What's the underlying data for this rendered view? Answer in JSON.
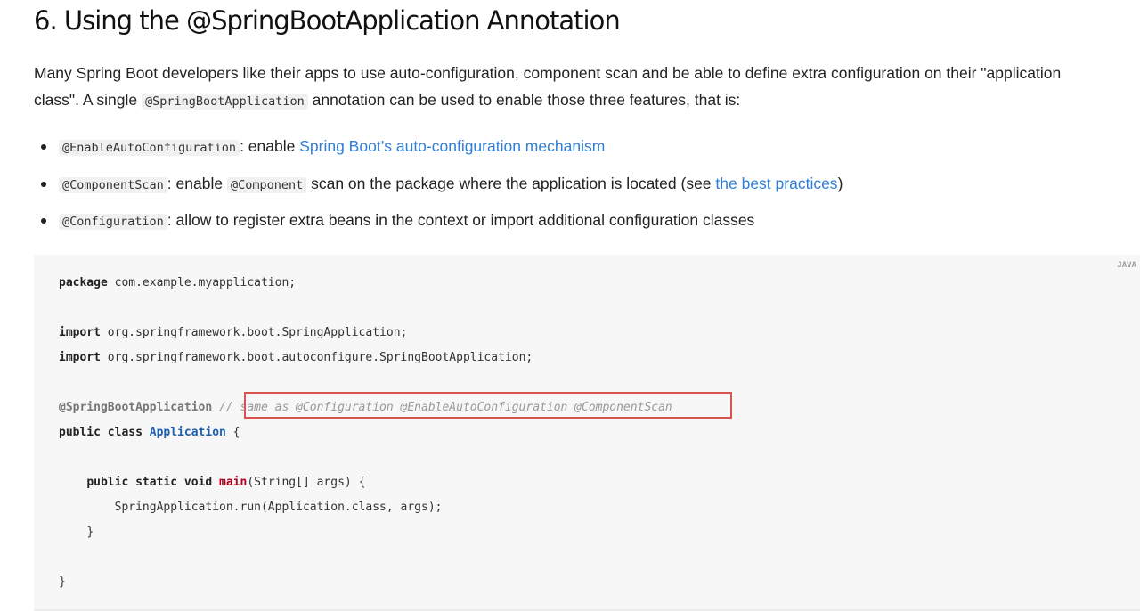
{
  "heading": "6. Using the @SpringBootApplication Annotation",
  "intro": {
    "text_1": "Many Spring Boot developers like their apps to use auto-configuration, component scan and be able to define extra configuration on their \"application class\". A single ",
    "code": "@SpringBootApplication",
    "text_2": " annotation can be used to enable those three features, that is:"
  },
  "bullets": [
    {
      "code": "@EnableAutoConfiguration",
      "text": ": enable ",
      "link": "Spring Boot’s auto-configuration mechanism"
    },
    {
      "code": "@ComponentScan",
      "text": ": enable ",
      "code2": "@Component",
      "text2": " scan on the package where the application is located (see ",
      "link": "the best practices",
      "text3": ")"
    },
    {
      "code": "@Configuration",
      "text": ": allow to register extra beans in the context or import additional configuration classes"
    }
  ],
  "code_block": {
    "language": "JAVA",
    "lines": {
      "l1_kw": "package",
      "l1_rest": " com.example.myapplication;",
      "l2_kw": "import",
      "l2_rest": " org.springframework.boot.SpringApplication;",
      "l3_kw": "import",
      "l3_rest": " org.springframework.boot.autoconfigure.SpringBootApplication;",
      "l4_ann": "@SpringBootApplication",
      "l4_comment": " // same as @Configuration @EnableAutoConfiguration @ComponentScan",
      "l5_kw": "public class",
      "l5_cls": "Application",
      "l5_rest": " {",
      "l6_kw": "public static void",
      "l6_fn": "main",
      "l6_rest": "(String[] args) {",
      "l7": "SpringApplication.run(Application.class, args);",
      "l8": "}",
      "l9": "}"
    },
    "highlight_color": "#d9534f"
  }
}
